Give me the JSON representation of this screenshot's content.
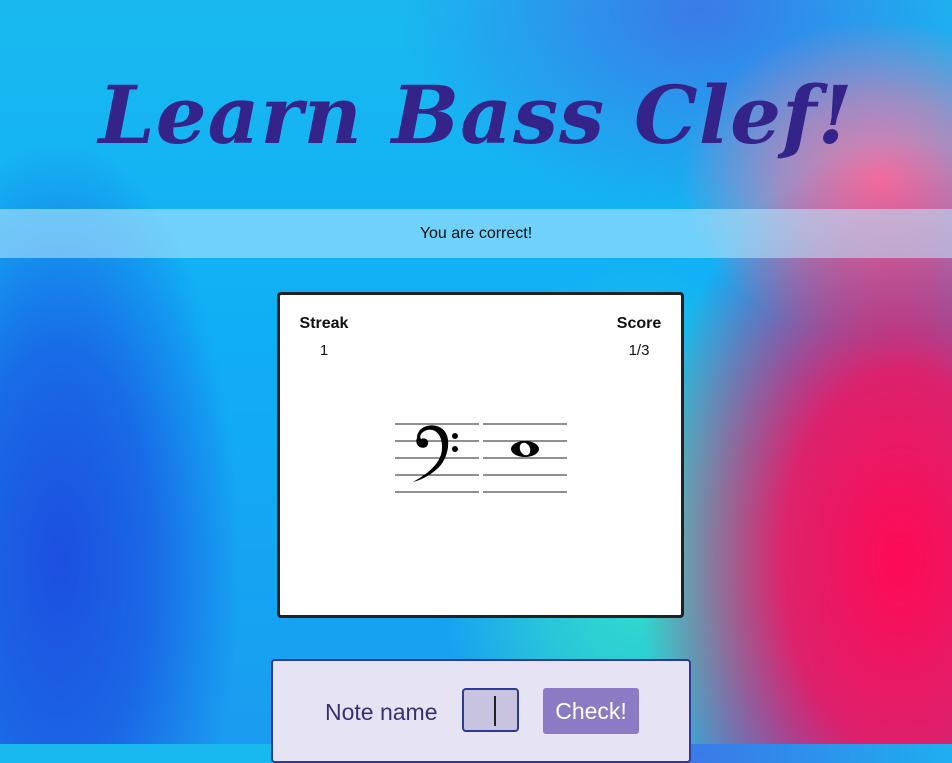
{
  "header": {
    "title": "Learn Bass Clef!"
  },
  "feedback": {
    "message": "You are correct!"
  },
  "stats": {
    "streak_label": "Streak",
    "streak_value": "1",
    "score_label": "Score",
    "score_value": "1/3"
  },
  "answer": {
    "label": "Note name",
    "input_value": "",
    "button_label": "Check!"
  },
  "colors": {
    "title": "#34248a",
    "button": "#8a7bc4",
    "panel": "#e6e3f5"
  },
  "icons": {
    "clef": "bass-clef-icon",
    "note": "whole-note-icon"
  }
}
